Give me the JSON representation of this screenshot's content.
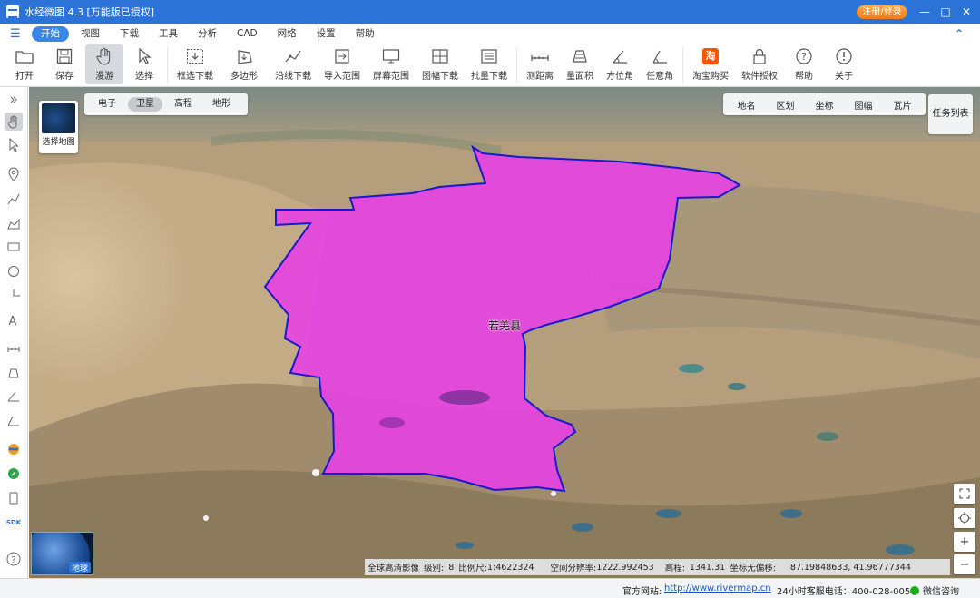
{
  "app": {
    "title": "水经微图 4.3 [万能版已授权]",
    "login_label": "注册/登录"
  },
  "menu": {
    "items": [
      "开始",
      "视图",
      "下载",
      "工具",
      "分析",
      "CAD",
      "网络",
      "设置",
      "帮助"
    ],
    "active": "开始"
  },
  "toolbar": {
    "tools": [
      {
        "label": "打开",
        "icon": "folder-icon"
      },
      {
        "label": "保存",
        "icon": "save-icon"
      },
      {
        "label": "漫游",
        "icon": "hand-icon"
      },
      {
        "label": "选择",
        "icon": "pointer-icon"
      },
      {
        "label": "框选下载",
        "icon": "box-download-icon"
      },
      {
        "label": "多边形",
        "icon": "polygon-icon"
      },
      {
        "label": "沿线下载",
        "icon": "line-download-icon"
      },
      {
        "label": "导入范围",
        "icon": "import-icon"
      },
      {
        "label": "屏幕范围",
        "icon": "screen-icon"
      },
      {
        "label": "图幅下载",
        "icon": "sheet-icon"
      },
      {
        "label": "批量下载",
        "icon": "batch-icon"
      },
      {
        "label": "测距离",
        "icon": "ruler-icon"
      },
      {
        "label": "量面积",
        "icon": "area-icon"
      },
      {
        "label": "方位角",
        "icon": "angle-icon"
      },
      {
        "label": "任意角",
        "icon": "any-angle-icon"
      },
      {
        "label": "淘宝购买",
        "icon": "taobao-icon"
      },
      {
        "label": "软件授权",
        "icon": "lock-icon"
      },
      {
        "label": "帮助",
        "icon": "help-icon"
      },
      {
        "label": "关于",
        "icon": "info-icon"
      }
    ]
  },
  "map": {
    "layer_switch_label": "选择地图",
    "map_types": [
      "电子",
      "卫星",
      "高程",
      "地形"
    ],
    "active_map_type": "卫星",
    "overlays": [
      "地名",
      "区划",
      "坐标",
      "图幅",
      "瓦片"
    ],
    "task_list_label": "任务列表",
    "region_label": "若羌县",
    "globe_label": "地球",
    "info": {
      "source": "全球高清影像",
      "level_label": "级别:",
      "level": "8",
      "scale_label": "比例尺:",
      "scale": "1:4622324",
      "resolution_label": "空间分辨率:",
      "resolution": "1222.992453",
      "elevation_label": "高程:",
      "elevation": "1341.31",
      "coord_label": "坐标无偏移:",
      "coords": "87.19848633, 41.96777344"
    },
    "colors": {
      "region_fill": "#e83fe6",
      "region_stroke": "#1a1acc"
    }
  },
  "status": {
    "site_label": "官方网站:",
    "site_url": "http://www.rivermap.cn",
    "phone": "24小时客服电话：400-028-0050",
    "wechat": "微信咨询"
  }
}
